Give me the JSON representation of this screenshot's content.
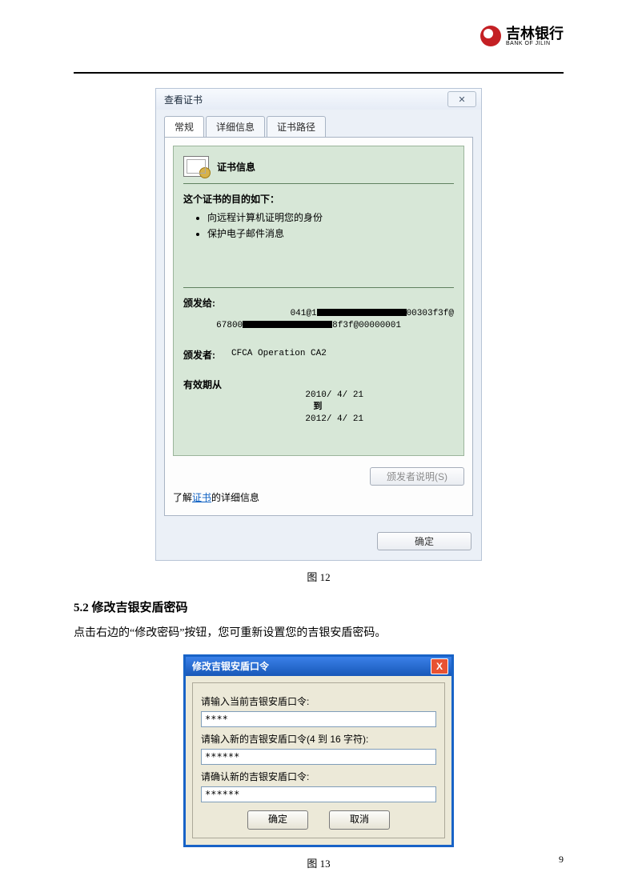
{
  "brand": {
    "cn": "吉林银行",
    "en": "BANK OF JILIN"
  },
  "cert_dialog": {
    "title": "查看证书",
    "close_glyph": "✕",
    "tabs": [
      "常规",
      "详细信息",
      "证书路径"
    ],
    "info_title": "证书信息",
    "purpose_title": "这个证书的目的如下：",
    "purposes": [
      "向远程计算机证明您的身份",
      "保护电子邮件消息"
    ],
    "issued_to_label": "颁发给:",
    "issued_to_line1_pre": "041@1",
    "issued_to_line1_post": "00303f3f@",
    "issued_to_line2_pre": "67800",
    "issued_to_line2_post": "8f3f@00000001",
    "issued_by_label": "颁发者:",
    "issued_by": "CFCA Operation CA2",
    "valid_from_label": "有效期从",
    "valid_from": "2010/ 4/ 21",
    "valid_to_label": "到",
    "valid_to": "2012/ 4/ 21",
    "issuer_stmt_btn": "颁发者说明(S)",
    "learn_more_pre": "了解",
    "learn_more_link": "证书",
    "learn_more_post": "的详细信息",
    "ok_btn": "确定"
  },
  "fig12": "图 12",
  "section": {
    "num": "5.2",
    "title": "修改吉银安盾密码"
  },
  "body_para": "点击右边的“修改密码”按钮，您可重新设置您的吉银安盾密码。",
  "pw_dialog": {
    "title": "修改吉银安盾口令",
    "close_glyph": "X",
    "label_current": "请输入当前吉银安盾口令:",
    "value_current": "****",
    "label_new": "请输入新的吉银安盾口令(4 到 16 字符):",
    "value_new": "******",
    "label_confirm": "请确认新的吉银安盾口令:",
    "value_confirm": "******",
    "ok_btn": "确定",
    "cancel_btn": "取消"
  },
  "fig13": "图 13",
  "page_number": "9"
}
